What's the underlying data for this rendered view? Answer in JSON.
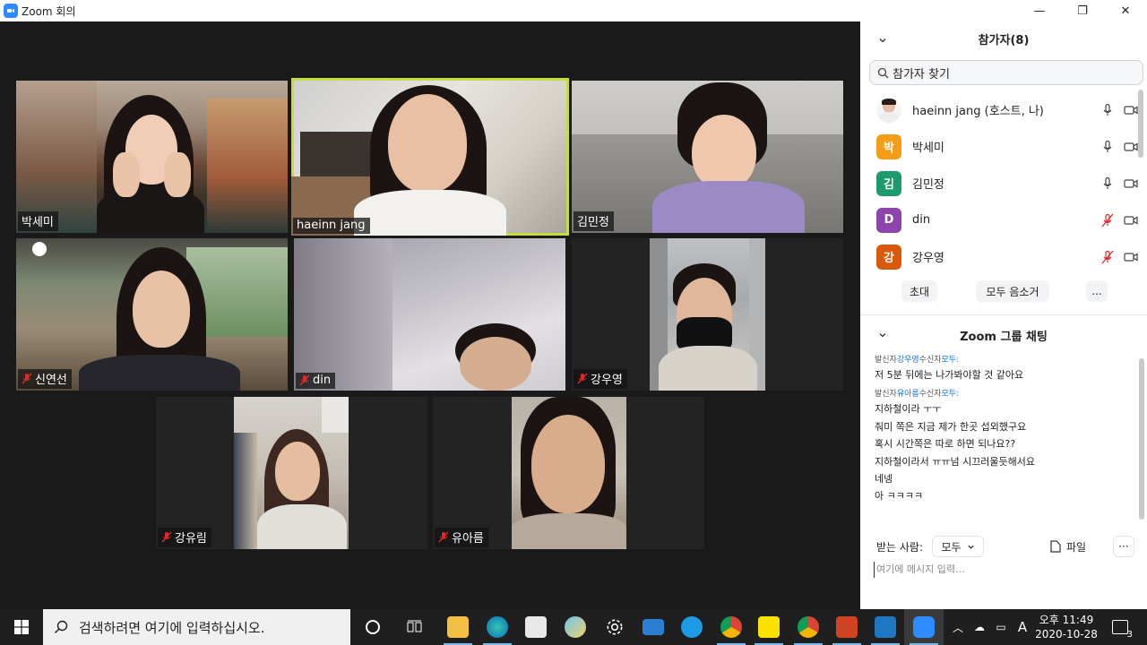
{
  "window": {
    "title": "Zoom 회의"
  },
  "tiles": [
    {
      "name": "박세미",
      "muted": false
    },
    {
      "name": "haeinn jang",
      "muted": false,
      "active": true
    },
    {
      "name": "김민정",
      "muted": false
    },
    {
      "name": "신연선",
      "muted": true
    },
    {
      "name": "din",
      "muted": true
    },
    {
      "name": "강우영",
      "muted": true
    },
    {
      "name": "강유림",
      "muted": true
    },
    {
      "name": "유아름",
      "muted": true
    }
  ],
  "participants_panel": {
    "title": "참가자(8)",
    "search_placeholder": "참가자 찾기",
    "list": [
      {
        "name": "haeinn jang (호스트, 나)",
        "avatar_letter": "",
        "avatar_color": "#ffffff",
        "muted": false
      },
      {
        "name": "박세미",
        "avatar_letter": "박",
        "avatar_color": "#f59c19",
        "muted": false
      },
      {
        "name": "김민정",
        "avatar_letter": "김",
        "avatar_color": "#1f9a6c",
        "muted": false
      },
      {
        "name": "din",
        "avatar_letter": "D",
        "avatar_color": "#8e44ad",
        "muted": true
      },
      {
        "name": "강우영",
        "avatar_letter": "강",
        "avatar_color": "#d9590b",
        "muted": true
      }
    ],
    "buttons": {
      "invite": "초대",
      "mute_all": "모두 음소거",
      "more": "..."
    }
  },
  "chat_panel": {
    "title": "Zoom 그룹 채팅",
    "messages": [
      {
        "sender_prefix": "발신자",
        "sender": "강우영",
        "mid": "수신자",
        "recipient": "모두:",
        "lines": [
          "저 5분 뒤에는 나가봐야할 것 같아요"
        ]
      },
      {
        "sender_prefix": "발신자",
        "sender": "유아름",
        "mid": "수신자",
        "recipient": "모두:",
        "lines": [
          "지하철이라 ㅜㅜ",
          "줘미 쪽은 지금 제가 한곳 섭외했구요",
          "혹시 시간쪽은 따로 하면 되나요??",
          "지하철이라서 ㅠㅠ넘 시끄러울듯해서요",
          "네넹",
          "아 ㅋㅋㅋㅋ"
        ]
      }
    ],
    "to_label": "받는 사람:",
    "to_value": "모두",
    "file_label": "파일",
    "more_label": "···",
    "input_placeholder": "여기에 메시지 입력..."
  },
  "taskbar": {
    "search_placeholder": "검색하려면 여기에 입력하십시오.",
    "time": "오후 11:49",
    "date": "2020-10-28",
    "ime": "A",
    "notifications": "3"
  },
  "colors": {
    "accent": "#0e72ed",
    "active_border": "#c7dd3b",
    "muted_red": "#e02828"
  }
}
